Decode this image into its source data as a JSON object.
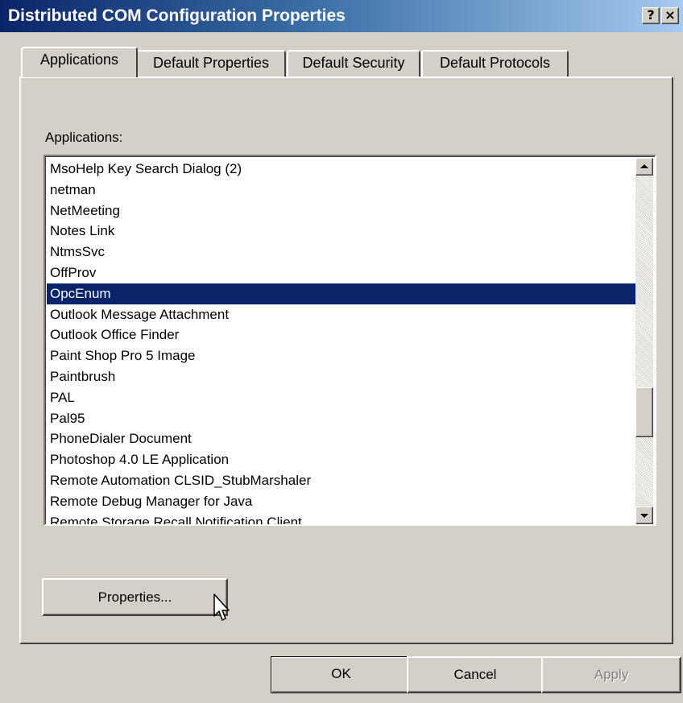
{
  "window": {
    "title": "Distributed COM Configuration Properties",
    "help_label": "?",
    "close_label": "×"
  },
  "tabs": [
    {
      "label": "Applications",
      "active": true
    },
    {
      "label": "Default Properties",
      "active": false
    },
    {
      "label": "Default Security",
      "active": false
    },
    {
      "label": "Default Protocols",
      "active": false
    }
  ],
  "applications": {
    "label": "Applications:",
    "selected": "OpcEnum",
    "items": [
      "MsoHelp Key Search Dialog (2)",
      "netman",
      "NetMeeting",
      "Notes Link",
      "NtmsSvc",
      "OffProv",
      "OpcEnum",
      "Outlook Message Attachment",
      "Outlook Office Finder",
      "Paint Shop Pro 5 Image",
      "Paintbrush",
      "PAL",
      "Pal95",
      "PhoneDialer Document",
      "Photoshop 4.0 LE Application",
      "Remote Automation CLSID_StubMarshaler",
      "Remote Debug Manager for Java",
      "Remote Storage Recall Notification Client"
    ]
  },
  "buttons": {
    "properties": "Properties...",
    "ok": "OK",
    "cancel": "Cancel",
    "apply": "Apply"
  },
  "colors": {
    "selection": "#0a246a",
    "face": "#d4d0c8",
    "disabled_text": "#808080"
  },
  "icons": {
    "scroll_up": "arrow-up",
    "scroll_down": "arrow-down",
    "cursor": "mouse-pointer"
  }
}
